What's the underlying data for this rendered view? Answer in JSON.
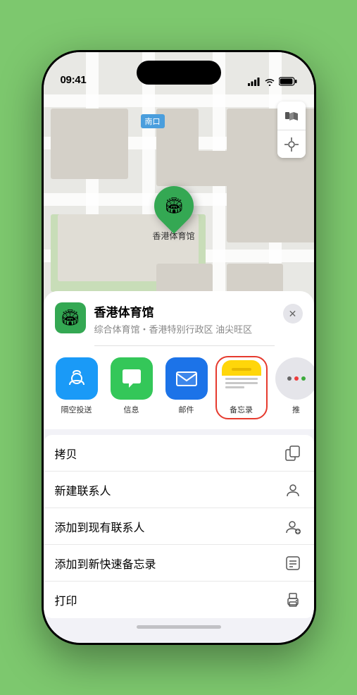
{
  "status_bar": {
    "time": "09:41",
    "arrow_icon": "▶"
  },
  "map": {
    "label": "南口"
  },
  "location": {
    "name": "香港体育馆",
    "subtitle": "综合体育馆・香港特别行政区 油尖旺区",
    "pin_label": "香港体育馆"
  },
  "share_apps": [
    {
      "id": "airdrop",
      "label": "隔空投送"
    },
    {
      "id": "messages",
      "label": "信息"
    },
    {
      "id": "mail",
      "label": "邮件"
    },
    {
      "id": "notes",
      "label": "备忘录"
    },
    {
      "id": "more",
      "label": "推"
    }
  ],
  "actions": [
    {
      "id": "copy",
      "label": "拷贝"
    },
    {
      "id": "new-contact",
      "label": "新建联系人"
    },
    {
      "id": "add-existing",
      "label": "添加到现有联系人"
    },
    {
      "id": "add-quick-note",
      "label": "添加到新快速备忘录"
    },
    {
      "id": "print",
      "label": "打印"
    }
  ],
  "icons": {
    "close": "✕",
    "location_pin": "🏟",
    "copy_icon": "⎘",
    "contact_icon": "👤",
    "add_contact_icon": "👤",
    "note_icon": "📋",
    "print_icon": "🖨"
  }
}
